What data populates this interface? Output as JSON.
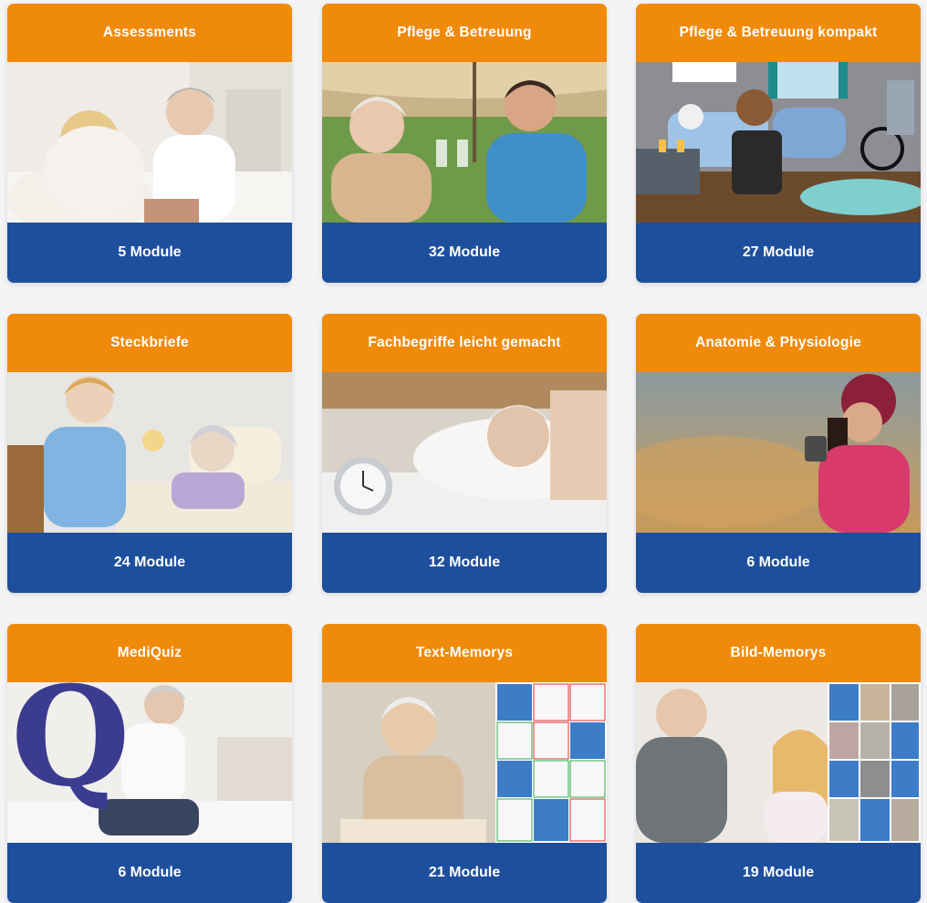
{
  "courses": [
    {
      "title": "Assessments",
      "modules": "5 Module",
      "image": "caregiver-chatting-with-elderly-woman-photo"
    },
    {
      "title": "Pflege & Betreuung",
      "modules": "32 Module",
      "image": "elderly-woman-and-nurse-toasting-photo"
    },
    {
      "title": "Pflege & Betreuung kompakt",
      "modules": "27 Module",
      "image": "cartoon-patient-room-illustration"
    },
    {
      "title": "Steckbriefe",
      "modules": "24 Module",
      "image": "nurse-caring-for-patient-illustration"
    },
    {
      "title": "Fachbegriffe leicht gemacht",
      "modules": "12 Module",
      "image": "woman-sleeping-with-alarm-clock-photo"
    },
    {
      "title": "Anatomie & Physiologie",
      "modules": "6 Module",
      "image": "woman-in-autumn-with-cup-photo"
    },
    {
      "title": "MediQuiz",
      "modules": "6 Module",
      "image": "man-sitting-on-bed-with-q-letter"
    },
    {
      "title": "Text-Memorys",
      "modules": "21 Module",
      "image": "elderly-woman-eating-with-memory-cards"
    },
    {
      "title": "Bild-Memorys",
      "modules": "19 Module",
      "image": "elderly-man-and-woman-with-memory-cards"
    }
  ],
  "colors": {
    "header": "#f08a0a",
    "footer": "#1e4f9c",
    "background": "#f4f4f6"
  },
  "images": {
    "mediquiz_letter": "Q"
  }
}
